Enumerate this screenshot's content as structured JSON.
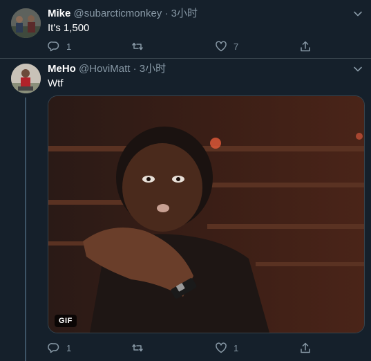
{
  "tweets": [
    {
      "name": "Mike",
      "handle": "@subarcticmonkey",
      "separator": "·",
      "time": "3小时",
      "text": "It's 1,500",
      "replies": "1",
      "retweets": "",
      "likes": "7"
    },
    {
      "name": "MeHo",
      "handle": "@HoviMatt",
      "separator": "·",
      "time": "3小时",
      "text": "Wtf",
      "media_badge": "GIF",
      "replies": "1",
      "retweets": "",
      "likes": "1"
    }
  ],
  "colors": {
    "background": "#15202b",
    "secondary_text": "#8899a6",
    "divider": "#38444d"
  },
  "icons": [
    "caret-down-icon",
    "reply-icon",
    "retweet-icon",
    "like-icon",
    "share-icon"
  ]
}
